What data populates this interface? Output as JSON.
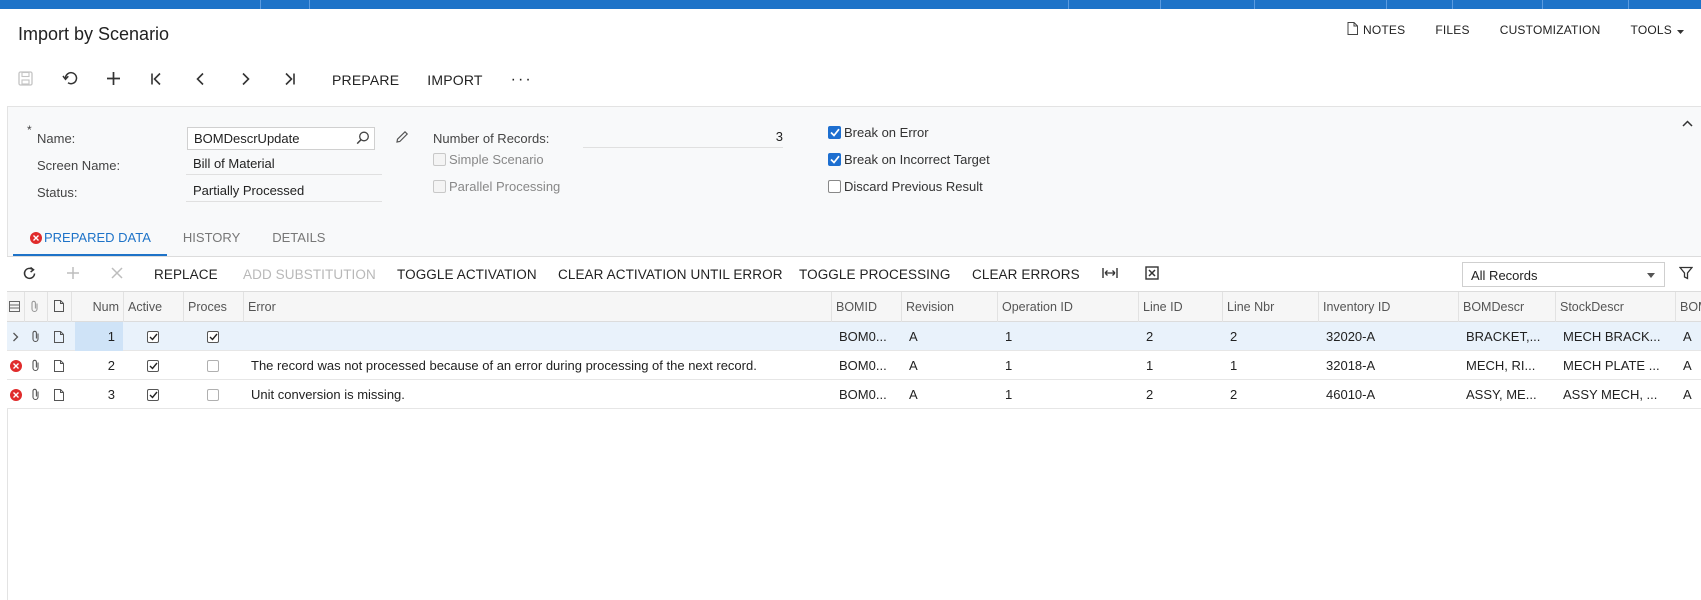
{
  "page": {
    "title": "Import by Scenario"
  },
  "top_links": {
    "notes": "NOTES",
    "files": "FILES",
    "customization": "CUSTOMIZATION",
    "tools": "TOOLS"
  },
  "toolbar": {
    "prepare": "PREPARE",
    "import": "IMPORT",
    "more": "···"
  },
  "form": {
    "name_label": "Name:",
    "name_required": "*",
    "name_value": "BOMDescrUpdate",
    "screen_name_label": "Screen Name:",
    "screen_name_value": "Bill of Material",
    "status_label": "Status:",
    "status_value": "Partially Processed",
    "num_records_label": "Number of Records:",
    "num_records_value": "3",
    "simple_scenario": {
      "label": "Simple Scenario",
      "checked": false
    },
    "parallel_processing": {
      "label": "Parallel Processing",
      "checked": false
    },
    "break_on_error": {
      "label": "Break on Error",
      "checked": true
    },
    "break_on_incorrect_target": {
      "label": "Break on Incorrect Target",
      "checked": true
    },
    "discard_previous_result": {
      "label": "Discard Previous Result",
      "checked": false
    }
  },
  "tabs": [
    {
      "label": "PREPARED DATA",
      "active": true
    },
    {
      "label": "HISTORY",
      "active": false
    },
    {
      "label": "DETAILS",
      "active": false
    }
  ],
  "grid_toolbar": {
    "replace": "REPLACE",
    "add_substitution": "ADD SUBSTITUTION",
    "toggle_activation": "TOGGLE ACTIVATION",
    "clear_activation_until_error": "CLEAR ACTIVATION UNTIL ERROR",
    "toggle_processing": "TOGGLE PROCESSING",
    "clear_errors": "CLEAR ERRORS",
    "filter_value": "All Records"
  },
  "grid": {
    "columns": [
      "Num",
      "Active",
      "Proces",
      "Error",
      "BOMID",
      "Revision",
      "Operation ID",
      "Line ID",
      "Line Nbr",
      "Inventory ID",
      "BOMDescr",
      "StockDescr",
      "BOM"
    ],
    "rows": [
      {
        "num": "1",
        "active": true,
        "processed": true,
        "has_error": false,
        "error": "",
        "bomid": "BOM0...",
        "revision": "A",
        "operation_id": "1",
        "line_id": "2",
        "line_nbr": "2",
        "inventory_id": "32020-A",
        "bomdescr": "BRACKET,...",
        "stockdescr": "MECH BRACK...",
        "bom": "A"
      },
      {
        "num": "2",
        "active": true,
        "processed": false,
        "has_error": true,
        "error": "The record was not processed because of an error during processing of the next record.",
        "bomid": "BOM0...",
        "revision": "A",
        "operation_id": "1",
        "line_id": "1",
        "line_nbr": "1",
        "inventory_id": "32018-A",
        "bomdescr": "MECH, RI...",
        "stockdescr": "MECH PLATE ...",
        "bom": "A"
      },
      {
        "num": "3",
        "active": true,
        "processed": false,
        "has_error": true,
        "error": "Unit conversion is missing.",
        "bomid": "BOM0...",
        "revision": "A",
        "operation_id": "1",
        "line_id": "2",
        "line_nbr": "2",
        "inventory_id": "46010-A",
        "bomdescr": "ASSY, ME...",
        "stockdescr": "ASSY MECH, ...",
        "bom": "A"
      }
    ]
  },
  "colors": {
    "accent": "#1e73c8",
    "error": "#e02b2b",
    "checkbox": "#1d6fd0"
  }
}
